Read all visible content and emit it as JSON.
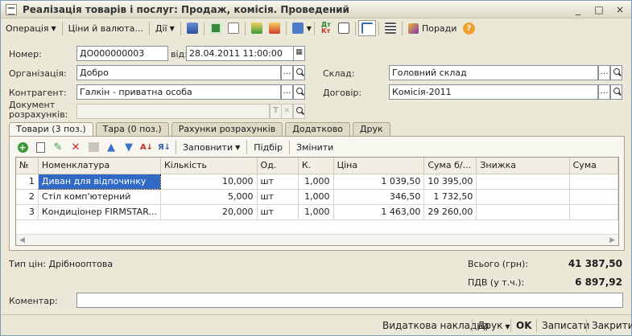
{
  "window": {
    "title": "Реалізація товарів і послуг: Продаж, комісія. Проведений",
    "controls": [
      "_",
      "□",
      "×"
    ]
  },
  "toolbar": {
    "operation": "Операція",
    "prices": "Ціни й валюта...",
    "actions": "Дії",
    "tips": "Поради"
  },
  "header": {
    "number_label": "Номер:",
    "number_value": "ДО000000003",
    "date_label": "від:",
    "date_value": "28.04.2011 11:00:00",
    "org_label": "Організація:",
    "org_value": "Добро",
    "warehouse_label": "Склад:",
    "warehouse_value": "Головний склад",
    "counterparty_label": "Контрагент:",
    "counterparty_value": "Галкін - приватна особа",
    "contract_label": "Договір:",
    "contract_value": "Комісія-2011",
    "settlement_label_1": "Документ",
    "settlement_label_2": "розрахунків:",
    "settlement_value": ""
  },
  "tabs": [
    {
      "label": "Товари (3 поз.)",
      "active": true
    },
    {
      "label": "Тара (0 поз.)",
      "active": false
    },
    {
      "label": "Рахунки розрахунків",
      "active": false
    },
    {
      "label": "Додатково",
      "active": false
    },
    {
      "label": "Друк",
      "active": false
    }
  ],
  "grid_toolbar": {
    "fill": "Заповнити",
    "select": "Підбір",
    "change": "Змінити"
  },
  "table": {
    "columns": [
      "№",
      "Номенклатура",
      "Кількість",
      "Од.",
      "К.",
      "Ціна",
      "Сума б/...",
      "Знижка",
      "Сума"
    ],
    "rows": [
      [
        "1",
        "Диван для відпочинку",
        "10,000",
        "шт",
        "1,000",
        "1 039,50",
        "10 395,00",
        "",
        ""
      ],
      [
        "2",
        "Стіл комп'ютерний",
        "5,000",
        "шт",
        "1,000",
        "346,50",
        "1 732,50",
        "",
        ""
      ],
      [
        "3",
        "Кондиціонер FIRMSTAR...",
        "20,000",
        "шт",
        "1,000",
        "1 463,00",
        "29 260,00",
        "",
        ""
      ]
    ]
  },
  "summary": {
    "price_type": "Тип цін: Дрібнооптова",
    "total_label": "Всього (грн):",
    "total_value": "41 387,50",
    "vat_label": "ПДВ (у т.ч.):",
    "vat_value": "6 897,92"
  },
  "comment": {
    "label": "Коментар:",
    "value": ""
  },
  "footer": {
    "invoice": "Видаткова накладна",
    "print": "Друк",
    "ok": "OK",
    "save": "Записати",
    "close": "Закрити"
  }
}
